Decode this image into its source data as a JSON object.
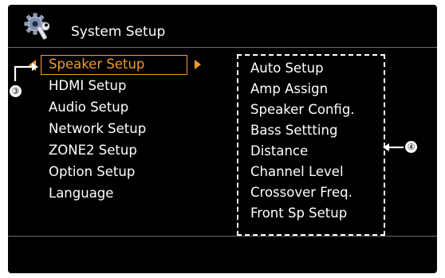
{
  "header": {
    "title": "System Setup",
    "icon": "gear-wrench-icon"
  },
  "menu": {
    "items": [
      {
        "label": "Speaker Setup",
        "selected": true
      },
      {
        "label": "HDMI Setup",
        "selected": false
      },
      {
        "label": "Audio Setup",
        "selected": false
      },
      {
        "label": "Network Setup",
        "selected": false
      },
      {
        "label": "ZONE2 Setup",
        "selected": false
      },
      {
        "label": "Option Setup",
        "selected": false
      },
      {
        "label": "Language",
        "selected": false
      }
    ]
  },
  "submenu": {
    "items": [
      "Auto Setup",
      "Amp Assign",
      "Speaker Config.",
      "Bass Settting",
      "Distance",
      "Channel Level",
      "Crossover Freq.",
      "Front Sp Setup"
    ]
  },
  "callouts": {
    "menu_cursor": "③",
    "submenu": "④"
  },
  "colors": {
    "background": "#000000",
    "highlight": "#f29a2e",
    "text": "#ffffff"
  }
}
